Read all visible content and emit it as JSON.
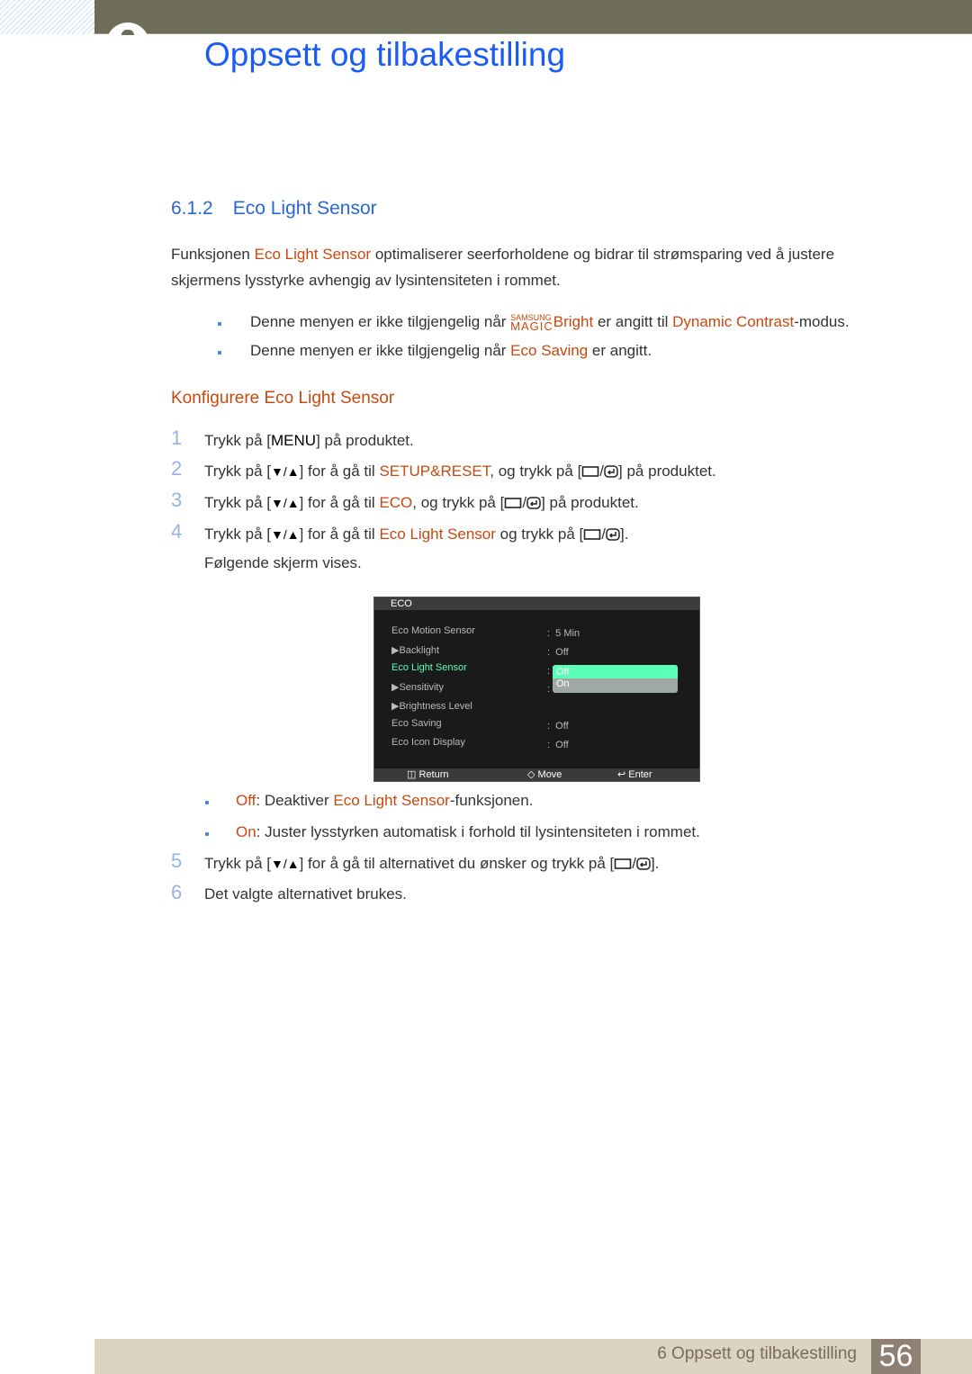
{
  "header": {
    "chapter_title": "Oppsett og tilbakestilling"
  },
  "section": {
    "number": "6.1.2",
    "title": "Eco Light Sensor"
  },
  "intro": {
    "a": "Funksjonen ",
    "b": "Eco Light Sensor",
    "c": " optimaliserer seerforholdene og bidrar til strømsparing ved å justere",
    "d": "skjermens lysstyrke avhengig av lysintensiteten i rommet."
  },
  "notes": [
    {
      "a": "Denne menyen er ikke tilgjengelig når ",
      "logo_top": "SAMSUNG",
      "logo_bottom": "MAGIC",
      "b": "Bright",
      "c": " er angitt til ",
      "d": "Dynamic Contrast",
      "e": "-modus."
    },
    {
      "a": "Denne menyen er ikke tilgjengelig når ",
      "b": "Eco Saving",
      "c": " er angitt."
    }
  ],
  "subheading": "Konfigurere Eco Light Sensor",
  "steps": [
    {
      "n": "1",
      "a": "Trykk på [",
      "key": "MENU",
      "b": "] på produktet."
    },
    {
      "n": "2",
      "a": "Trykk på [",
      "arrows": "▼/▲",
      "b": "] for å gå til ",
      "hl": "SETUP&RESET",
      "c": ", og trykk på [",
      "d": "] på produktet."
    },
    {
      "n": "3",
      "a": "Trykk på [",
      "arrows": "▼/▲",
      "b": "] for å gå til ",
      "hl": "ECO",
      "c": ", og trykk på [",
      "d": "] på produktet."
    },
    {
      "n": "4",
      "a": "Trykk på [",
      "arrows": "▼/▲",
      "b": "] for å gå til ",
      "hl": "Eco Light Sensor",
      "c": " og trykk på [",
      "d": "].",
      "e": "Følgende skjerm vises."
    },
    {
      "n": "5",
      "a": "Trykk på [",
      "arrows": "▼/▲",
      "b": "] for å gå til alternativet du ønsker og trykk på [",
      "d": "]."
    },
    {
      "n": "6",
      "a": "Det valgte alternativet brukes."
    }
  ],
  "osd": {
    "title": "ECO",
    "items": [
      {
        "label": "Eco Motion Sensor",
        "value": "5 Min"
      },
      {
        "label": "▶Backlight",
        "value": "Off"
      },
      {
        "label": "Eco Light Sensor",
        "value": ""
      },
      {
        "label": "▶Sensitivity",
        "value": ""
      },
      {
        "label": "▶Brightness Level",
        "value": ""
      },
      {
        "label": "Eco Saving",
        "value": "Off"
      },
      {
        "label": "Eco Icon Display",
        "value": "Off"
      }
    ],
    "options": [
      "Off",
      "On"
    ],
    "selected": "Off",
    "footer": {
      "return": "Return",
      "move": "Move",
      "enter": "Enter"
    },
    "colors": {
      "active": "#5cffb9"
    }
  },
  "options_desc": [
    {
      "hl": "Off",
      "a": ": Deaktiver ",
      "b": "Eco Light Sensor",
      "c": "-funksjonen."
    },
    {
      "hl": "On",
      "a": ": Juster lysstyrken automatisk i forhold til lysintensiteten i rommet."
    }
  ],
  "footer": {
    "chapter": "6 Oppsett og tilbakestilling",
    "page": "56"
  },
  "colors": {
    "title": "#1a5cf5",
    "highlight": "#c8490f",
    "footer_bg": "#dbd4c0"
  }
}
